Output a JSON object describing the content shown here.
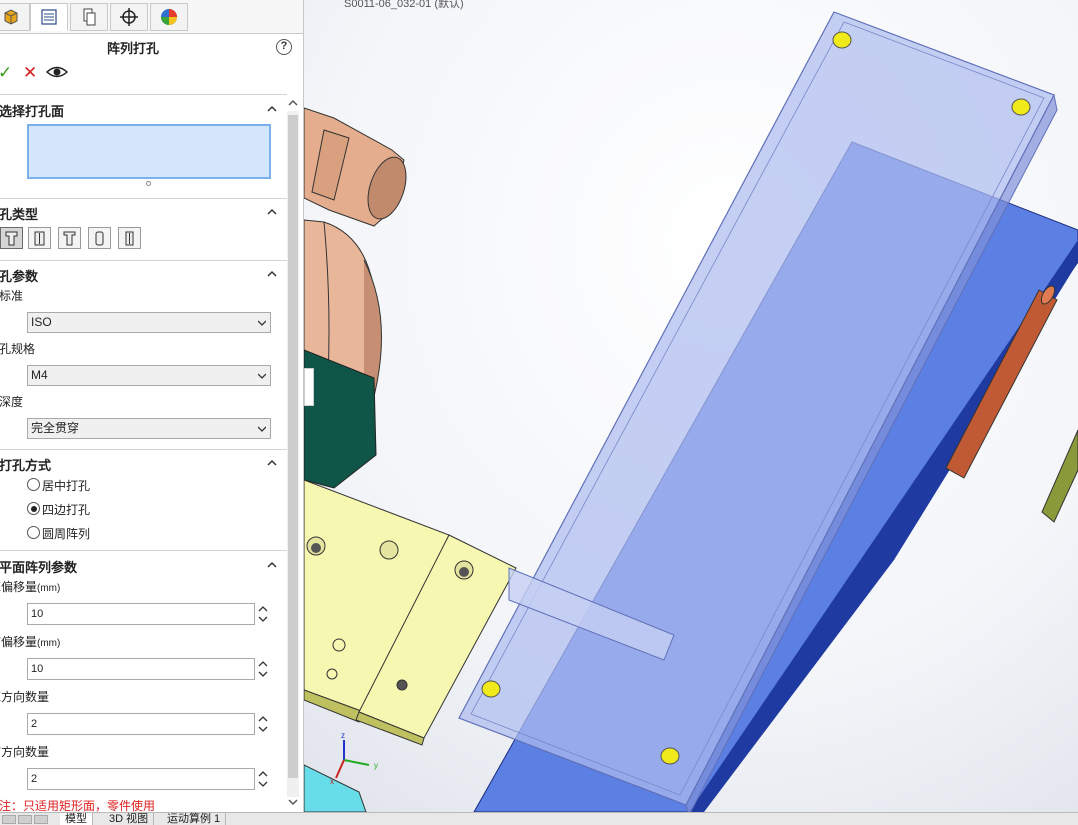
{
  "panel": {
    "title": "阵列打孔",
    "sections": {
      "select_face": {
        "title": "选择打孔面"
      },
      "hole_type": {
        "title": "孔类型"
      },
      "hole_params": {
        "title": "孔参数",
        "standard_label": "标准",
        "standard_value": "ISO",
        "size_label": "孔规格",
        "size_value": "M4",
        "depth_label": "深度",
        "depth_value": "完全贯穿"
      },
      "drill_method": {
        "title": "打孔方式",
        "options": [
          "居中打孔",
          "四边打孔",
          "圆周阵列"
        ],
        "selected": "四边打孔"
      },
      "pattern_params": {
        "title": "平面阵列参数",
        "x_offset_label": "X偏移量",
        "y_offset_label": "Y偏移量",
        "unit": "(mm)",
        "x_offset_value": "10",
        "y_offset_value": "10",
        "x_count_label": "X方向数量",
        "x_count_value": "2",
        "y_count_label": "Y方向数量",
        "y_count_value": "2"
      }
    },
    "note": "注：只适用矩形面，零件使用"
  },
  "bottom_tabs": [
    "模型",
    "3D 视图",
    "运动算例 1"
  ],
  "viewport": {
    "file_label": "S0011-06_032-01 (默认)"
  },
  "colors": {
    "accent_blue": "#7ab0ec",
    "ok_green": "#3a9a1a",
    "cancel_red": "#d42020",
    "note_red": "#e02020",
    "plate_blue": "#5b7fe3",
    "transparent_plate": "#aebdf0",
    "yellow_part": "#f6f7b0",
    "hole_marker": "#f0ea1a"
  },
  "icons": {
    "tabs": [
      "feature-manager-icon",
      "property-manager-icon",
      "configuration-manager-icon",
      "dimxpert-icon",
      "display-manager-icon"
    ],
    "actions": [
      "ok-check-icon",
      "cancel-x-icon",
      "preview-eye-icon",
      "help-icon"
    ]
  }
}
